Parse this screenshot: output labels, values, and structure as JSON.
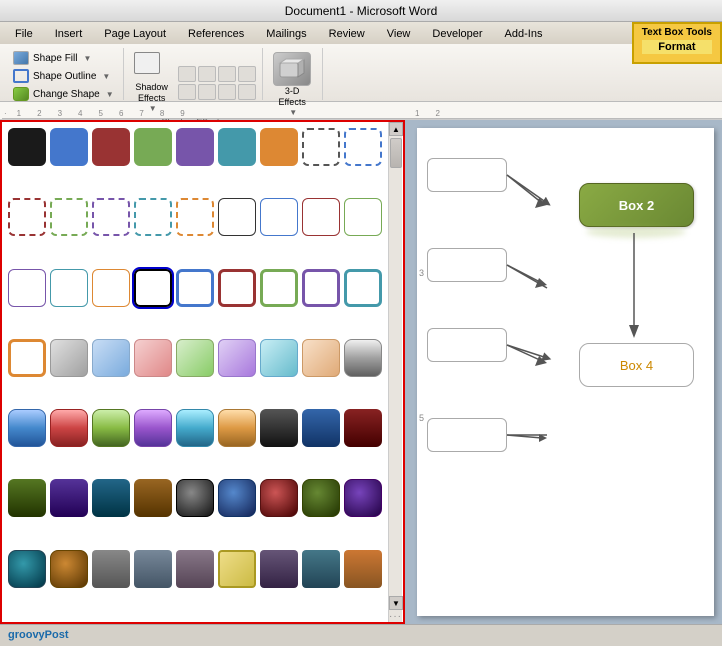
{
  "titleBar": {
    "text": "Document1 - Microsoft Word"
  },
  "tabs": [
    {
      "label": "File",
      "active": false
    },
    {
      "label": "Insert",
      "active": false
    },
    {
      "label": "Page Layout",
      "active": false
    },
    {
      "label": "References",
      "active": false
    },
    {
      "label": "Mailings",
      "active": false
    },
    {
      "label": "Review",
      "active": false
    },
    {
      "label": "View",
      "active": false
    },
    {
      "label": "Developer",
      "active": false
    },
    {
      "label": "Add-Ins",
      "active": false
    }
  ],
  "contextTab": {
    "title": "Text Box Tools",
    "subtitle": "Format"
  },
  "ribbon": {
    "groups": [
      {
        "name": "shape_fill_group",
        "buttons": [
          {
            "label": "Shape Fill",
            "icon": "shape-fill-icon"
          },
          {
            "label": "Shape Outline",
            "icon": "shape-outline-icon"
          },
          {
            "label": "Change Shape",
            "icon": "change-shape-icon"
          }
        ]
      },
      {
        "name": "shadow_effects_group",
        "label": "Shadow Effects",
        "buttons": [
          {
            "label": "Shadow Effects",
            "icon": "shadow-effects-icon"
          }
        ]
      },
      {
        "name": "3d_effects_group",
        "label": "3-D Effects",
        "buttons": [
          {
            "label": "3-D Effects",
            "icon": "3d-effects-icon"
          }
        ]
      }
    ]
  },
  "shapePanel": {
    "rows": [
      [
        "s-black",
        "s-blue",
        "s-darkred",
        "s-green",
        "s-purple",
        "s-teal",
        "s-orange"
      ],
      [
        "s-dash-black",
        "s-dash-blue",
        "s-dash-red",
        "s-dash-green",
        "s-dash-purple",
        "s-dash-teal",
        "s-dash-orange"
      ],
      [
        "s-outline-black",
        "s-outline-blue",
        "s-outline-red",
        "s-outline-green",
        "s-outline-purple",
        "s-outline-teal",
        "s-outline-orange"
      ],
      [
        "s-thick-black",
        "s-thick-blue",
        "s-thick-red",
        "s-thick-green",
        "s-thick-purple",
        "s-thick-teal",
        "s-thick-orange"
      ],
      [
        "s-grad-gray",
        "s-grad-blue",
        "s-grad-pink",
        "s-grad-green",
        "s-grad-purple",
        "s-grad-teal",
        "s-grad-peach"
      ],
      [
        "s-shiny-gray",
        "s-shiny-blue",
        "s-shiny-red",
        "s-shiny-green",
        "s-shiny-purple",
        "s-shiny-teal",
        "s-shiny-orange"
      ],
      [
        "s-dark-black",
        "s-dark-blue",
        "s-dark-red",
        "s-dark-green",
        "s-dark-purple",
        "s-dark-teal",
        "s-dark-orange"
      ],
      [
        "s-ds-black",
        "s-ds-blue",
        "s-ds-red",
        "s-ds-green",
        "s-ds-purple",
        "s-ds-teal",
        "s-ds-orange"
      ],
      [
        "s-flat-dark",
        "s-flat-slate",
        "s-flat-maroon",
        "s-flat-yellow",
        "s-flat-dpurple",
        "s-flat-dteal",
        "s-flat-dorange"
      ]
    ]
  },
  "document": {
    "boxes": [
      {
        "id": "box2",
        "label": "Box 2",
        "class": "box2"
      },
      {
        "id": "box4",
        "label": "Box 4",
        "class": "box4"
      }
    ]
  },
  "statusBar": {
    "text": "groovyPost"
  }
}
